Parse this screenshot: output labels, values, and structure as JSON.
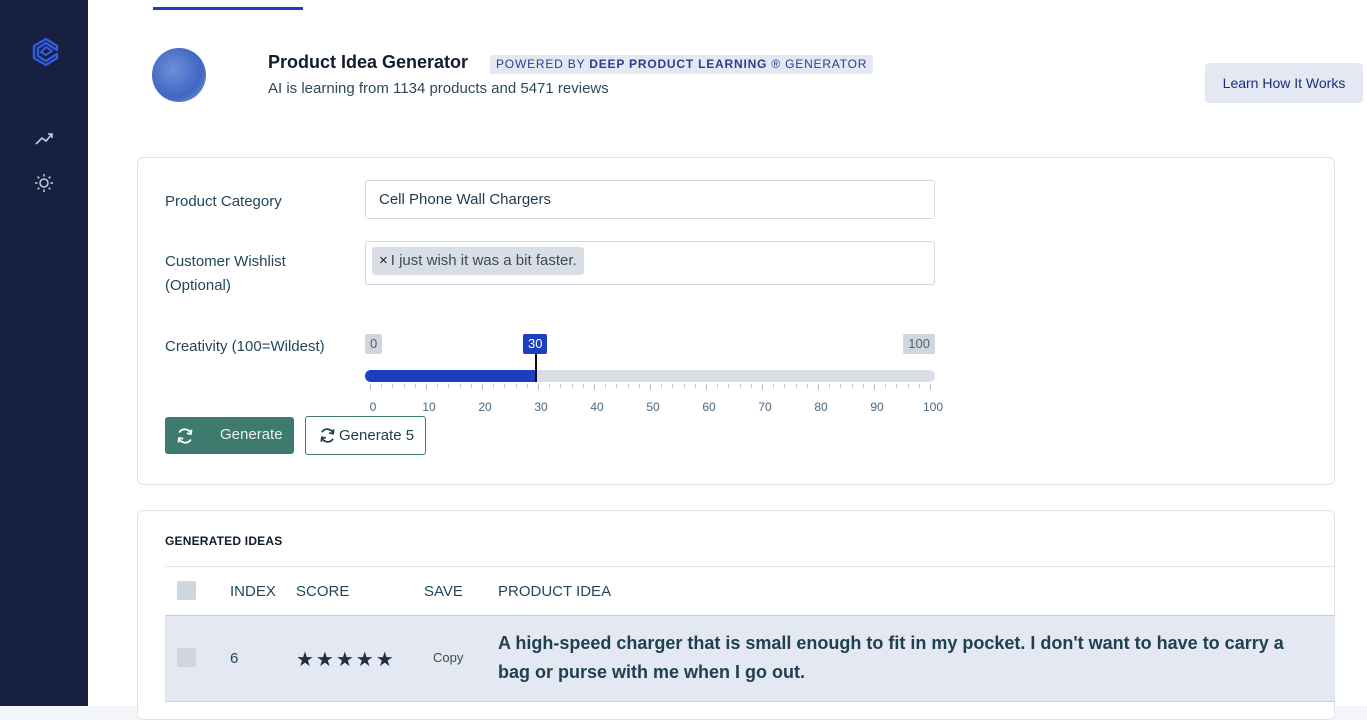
{
  "sidebar": {
    "icons": [
      "logo-icon",
      "trending-up-icon",
      "sun-icon"
    ]
  },
  "header": {
    "title": "Product Idea Generator",
    "powered_prefix": "POWERED BY ",
    "powered_brand": "DEEP PRODUCT LEARNING",
    "powered_mark": " ® ",
    "powered_suffix": "GENERATOR",
    "subtitle": "AI is learning from 1134 products and 5471 reviews",
    "learn_button": "Learn How It Works"
  },
  "form": {
    "category_label": "Product Category",
    "category_value": "Cell Phone Wall Chargers",
    "wishlist_label_line1": "Customer Wishlist",
    "wishlist_label_line2": "(Optional)",
    "wishlist_tag": "I just wish it was a bit faster.",
    "wishlist_tag_remove": "×",
    "creativity_label": "Creativity (100=Wildest)",
    "slider": {
      "min": 0,
      "max": 100,
      "value": 30,
      "min_label": "0",
      "max_label": "100",
      "value_label": "30",
      "tick_labels": [
        "0",
        "10",
        "20",
        "30",
        "40",
        "50",
        "60",
        "70",
        "80",
        "90",
        "100"
      ]
    },
    "generate_button": "Generate",
    "generate5_button": "Generate 5"
  },
  "ideas": {
    "section_title": "GENERATED IDEAS",
    "columns": [
      "INDEX",
      "SCORE",
      "SAVE",
      "PRODUCT IDEA"
    ],
    "rows": [
      {
        "index": "6",
        "stars": "★★★★★",
        "score": 5,
        "save": "Copy",
        "idea": "A high-speed charger that is small enough to fit in my pocket. I don't want to have to carry a bag or purse with me when I go out."
      }
    ]
  },
  "colors": {
    "sidebar_bg": "#172040",
    "accent_blue": "#1b3fbf",
    "generate_green": "#3f7a6e",
    "row_highlight": "#e3e8f2"
  }
}
